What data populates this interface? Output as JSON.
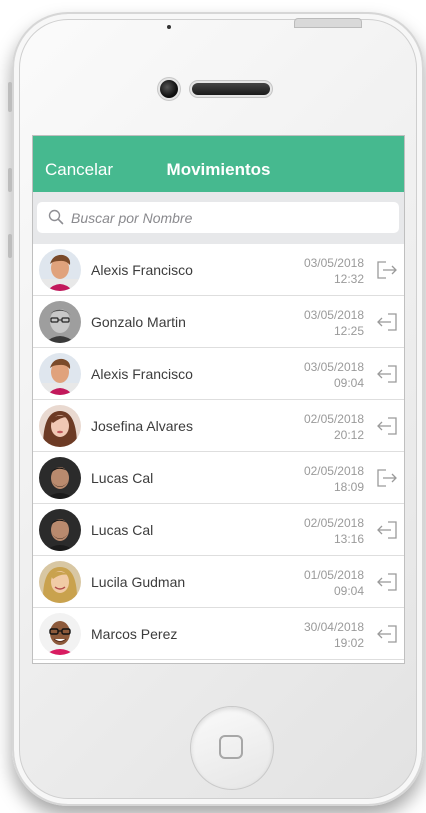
{
  "colors": {
    "accent": "#46b98f",
    "search_bar_bg": "#e7e8ea",
    "muted_text": "#9a9a9a",
    "name_text": "#3c3c3c"
  },
  "header": {
    "cancel_label": "Cancelar",
    "title": "Movimientos"
  },
  "search": {
    "placeholder": "Buscar por Nombre",
    "icon": "search-icon"
  },
  "movements": [
    {
      "name": "Alexis Francisco",
      "date": "03/05/2018",
      "time": "12:32",
      "direction": "exit-icon"
    },
    {
      "name": "Gonzalo Martin",
      "date": "03/05/2018",
      "time": "12:25",
      "direction": "entry-icon"
    },
    {
      "name": "Alexis Francisco",
      "date": "03/05/2018",
      "time": "09:04",
      "direction": "entry-icon"
    },
    {
      "name": "Josefina Alvares",
      "date": "02/05/2018",
      "time": "20:12",
      "direction": "entry-icon"
    },
    {
      "name": "Lucas Cal",
      "date": "02/05/2018",
      "time": "18:09",
      "direction": "exit-icon"
    },
    {
      "name": "Lucas Cal",
      "date": "02/05/2018",
      "time": "13:16",
      "direction": "entry-icon"
    },
    {
      "name": "Lucila Gudman",
      "date": "01/05/2018",
      "time": "09:04",
      "direction": "entry-icon"
    },
    {
      "name": "Marcos Perez",
      "date": "30/04/2018",
      "time": "19:02",
      "direction": "entry-icon"
    }
  ]
}
